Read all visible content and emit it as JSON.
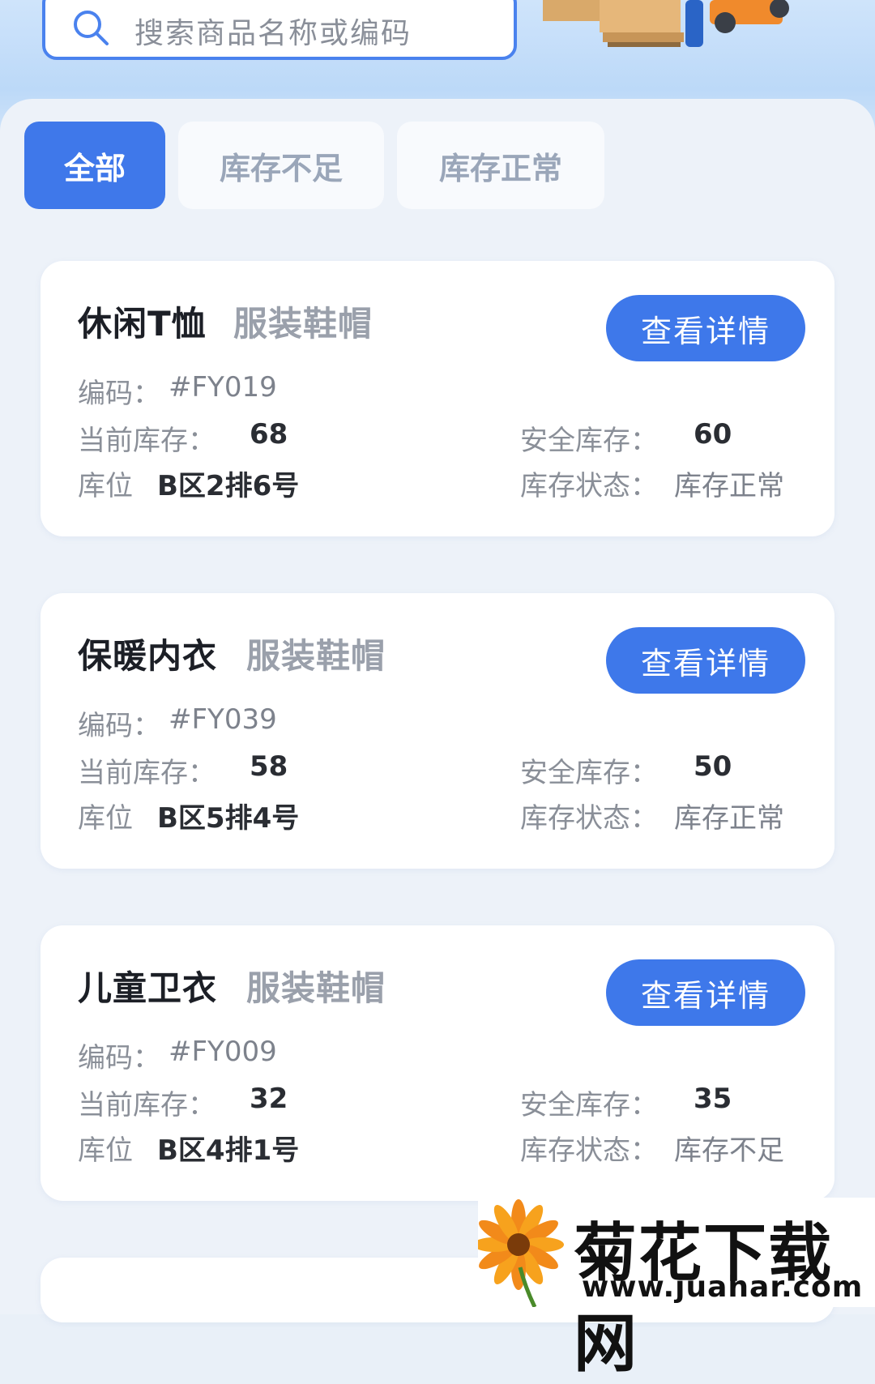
{
  "search": {
    "placeholder": "搜索商品名称或编码",
    "icon": "search-icon"
  },
  "tabs": [
    {
      "label": "全部",
      "active": true
    },
    {
      "label": "库存不足",
      "active": false
    },
    {
      "label": "库存正常",
      "active": false
    }
  ],
  "labels": {
    "code": "编码：",
    "current_stock": "当前库存：",
    "safety_stock": "安全库存：",
    "location": "库位",
    "status": "库存状态：",
    "detail_button": "查看详情"
  },
  "items": [
    {
      "name": "休闲T恤",
      "category": "服装鞋帽",
      "code": "#FY019",
      "current_stock": "68",
      "safety_stock": "60",
      "location": "B区2排6号",
      "status": "库存正常"
    },
    {
      "name": "保暖内衣",
      "category": "服装鞋帽",
      "code": "#FY039",
      "current_stock": "58",
      "safety_stock": "50",
      "location": "B区5排4号",
      "status": "库存正常"
    },
    {
      "name": "儿童卫衣",
      "category": "服装鞋帽",
      "code": "#FY009",
      "current_stock": "32",
      "safety_stock": "35",
      "location": "B区4排1号",
      "status": "库存不足"
    }
  ],
  "watermark": {
    "title": "菊花下载网",
    "url": "www.juahar.com"
  },
  "colors": {
    "accent": "#3f78ea",
    "background": "#edf2f9"
  }
}
